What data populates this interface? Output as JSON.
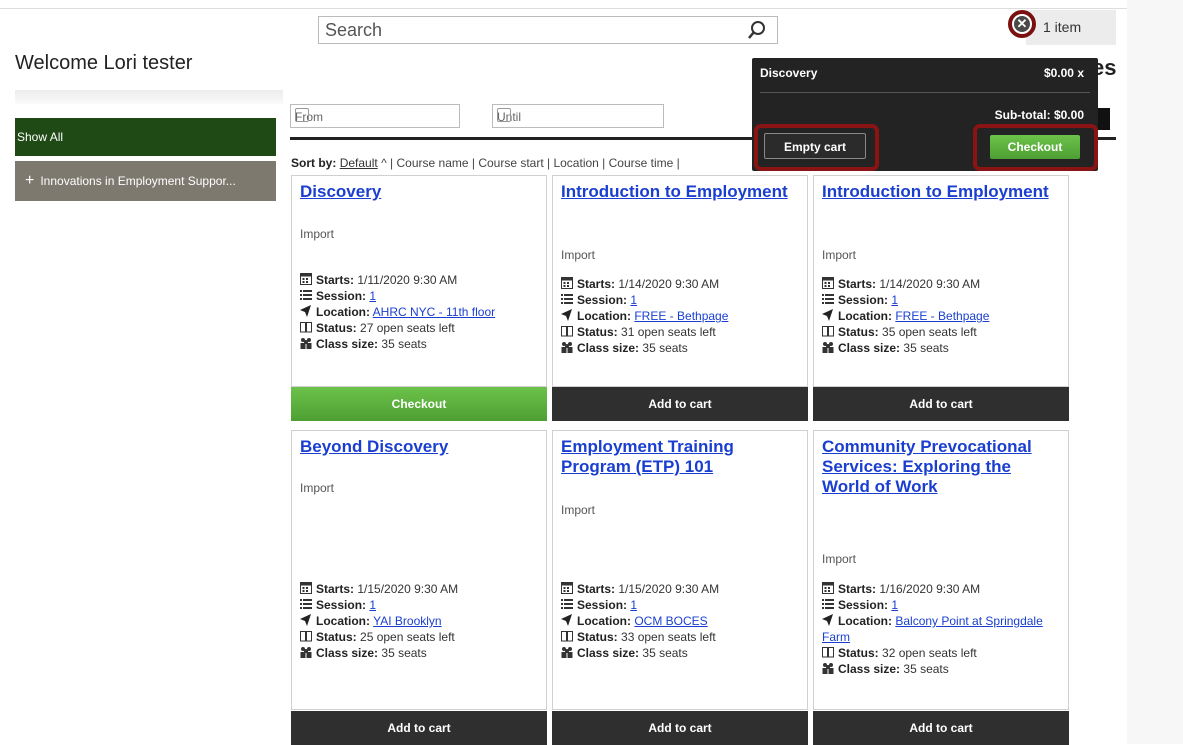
{
  "search": {
    "placeholder": "Search",
    "icon": "search-icon"
  },
  "welcome": "Welcome Lori tester",
  "cart": {
    "count_label": "1 item",
    "close_icon": "close-icon",
    "peek_text": "es"
  },
  "sidebar": {
    "show_all": "Show All",
    "categories": [
      {
        "plus": "+",
        "label": "Innovations in Employment Suppor..."
      }
    ]
  },
  "filters": {
    "from": "From",
    "until": "Until"
  },
  "sort": {
    "label": "Sort by:",
    "default": "Default",
    "arrow": "^",
    "rest": "| Course name | Course start | Location | Course time |"
  },
  "labels": {
    "starts": "Starts:",
    "session": "Session:",
    "location": "Location:",
    "status": "Status:",
    "class_size": "Class size:"
  },
  "courses": [
    {
      "title": "Discovery",
      "provider": "Import",
      "starts": "1/11/2020 9:30 AM",
      "session": "1",
      "location": "AHRC NYC - 11th floor",
      "status": "27 open seats left",
      "class_size": "35 seats",
      "button": "Checkout"
    },
    {
      "title": "Introduction to Employment",
      "provider": "Import",
      "starts": "1/14/2020 9:30 AM",
      "session": "1",
      "location": "FREE - Bethpage",
      "status": "31 open seats left",
      "class_size": "35 seats",
      "button": "Add to cart"
    },
    {
      "title": "Introduction to Employment",
      "provider": "Import",
      "starts": "1/14/2020 9:30 AM",
      "session": "1",
      "location": "FREE - Bethpage",
      "status": "35 open seats left",
      "class_size": "35 seats",
      "button": "Add to cart"
    },
    {
      "title": "Beyond Discovery",
      "provider": "Import",
      "starts": "1/15/2020 9:30 AM",
      "session": "1",
      "location": "YAI Brooklyn",
      "status": "25 open seats left",
      "class_size": "35 seats",
      "button": "Add to cart"
    },
    {
      "title": "Employment Training Program (ETP) 101",
      "provider": "Import",
      "starts": "1/15/2020 9:30 AM",
      "session": "1",
      "location": "OCM BOCES",
      "status": "33 open seats left",
      "class_size": "35 seats",
      "button": "Add to cart"
    },
    {
      "title": "Community Prevocational Services: Exploring the World of Work",
      "provider": "Import",
      "starts": "1/16/2020 9:30 AM",
      "session": "1",
      "location": "Balcony Point at Springdale Farm",
      "status": "32 open seats left",
      "class_size": "35 seats",
      "button": "Add to cart"
    }
  ],
  "popup": {
    "item_title": "Discovery",
    "item_price": "$0.00",
    "remove": "x",
    "subtotal": "Sub-total: $0.00",
    "empty_cart": "Empty cart",
    "checkout": "Checkout"
  },
  "colors": {
    "link": "#1a3fd0",
    "sidebar_active": "#1f4a15",
    "sidebar_category": "#7d796f",
    "checkout_green": "#5cb33e",
    "highlight": "#8a1414"
  }
}
